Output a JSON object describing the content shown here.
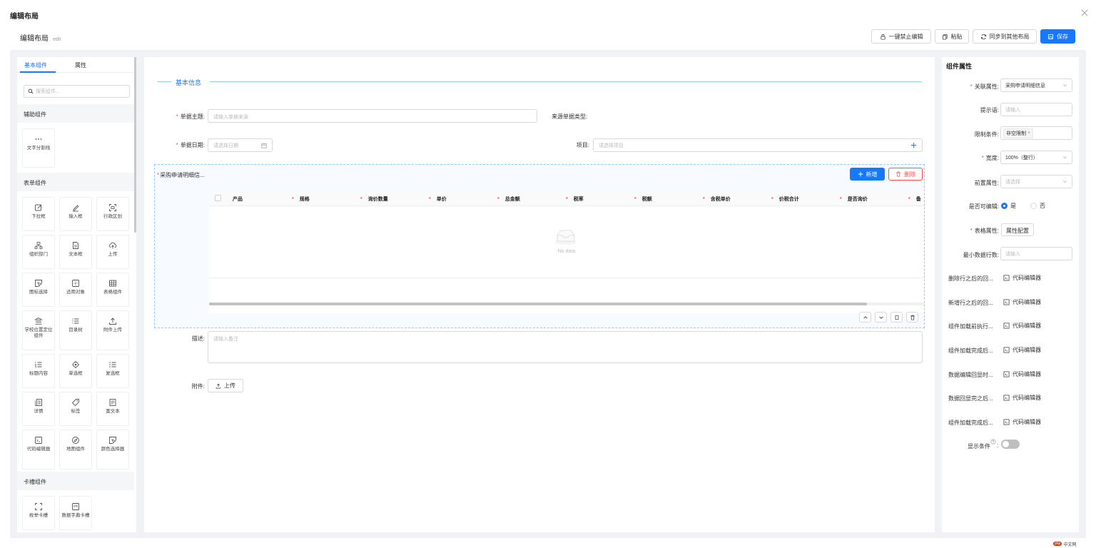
{
  "dialog": {
    "title": "编辑布局"
  },
  "subheader": {
    "title": "编辑布局",
    "tag": "edit"
  },
  "toolbar": {
    "disable_edit": "一键禁止编辑",
    "paste": "粘贴",
    "sync": "同步到其他布局",
    "save": "保存"
  },
  "left": {
    "tabs": [
      "基本组件",
      "属性"
    ],
    "search_placeholder": "搜索组件...",
    "groups": {
      "aux": "辅助组件",
      "form": "表单组件",
      "slot": "卡槽组件"
    },
    "aux_items": [
      {
        "icon": "ellipsis-icon",
        "label": "文字分割线"
      }
    ],
    "form_items": [
      {
        "icon": "edit-icon",
        "label": "下拉框"
      },
      {
        "icon": "pencil-icon",
        "label": "输入框"
      },
      {
        "icon": "region-scan-icon",
        "label": "行政区划"
      },
      {
        "icon": "org-tree-icon",
        "label": "组织部门"
      },
      {
        "icon": "document-icon",
        "label": "文本框"
      },
      {
        "icon": "cloud-upload-icon",
        "label": "上传"
      },
      {
        "icon": "cursor-select-icon",
        "label": "图标选择"
      },
      {
        "icon": "target-box-icon",
        "label": "适用对象"
      },
      {
        "icon": "table-grid-icon",
        "label": "表格组件"
      },
      {
        "icon": "bank-icon",
        "label": "学校位置定位组件"
      },
      {
        "icon": "list-icon",
        "label": "目录树"
      },
      {
        "icon": "upload-icon",
        "label": "附件上传"
      },
      {
        "icon": "ordered-list-icon",
        "label": "标题内容"
      },
      {
        "icon": "aim-icon",
        "label": "单选框"
      },
      {
        "icon": "checklist-icon",
        "label": "复选框"
      },
      {
        "icon": "detail-icon",
        "label": "详情"
      },
      {
        "icon": "tag-icon",
        "label": "标签"
      },
      {
        "icon": "rich-text-icon",
        "label": "富文本"
      },
      {
        "icon": "code-icon",
        "label": "代码编辑器"
      },
      {
        "icon": "compass-icon",
        "label": "地图组件"
      },
      {
        "icon": "color-select-icon",
        "label": "颜色选择器"
      }
    ],
    "slot_items": [
      {
        "icon": "expand-icon",
        "label": "枚举卡槽"
      },
      {
        "icon": "dict-icon",
        "label": "数据字典卡槽"
      }
    ]
  },
  "form": {
    "section_title": "基本信息",
    "subject_label": "单据主题:",
    "subject_placeholder": "请输入单据来源",
    "source_type_label": "来源单据类型:",
    "date_label": "单据日期:",
    "date_placeholder": "请选择日期",
    "project_label": "项目:",
    "project_placeholder": "请选择项目",
    "desc_label": "描述:",
    "desc_placeholder": "请输入备注",
    "attach_label": "附件:",
    "upload_btn": "上传"
  },
  "subtable": {
    "label": "采购申请明细信...",
    "add_btn": "新增",
    "delete_btn": "删除",
    "columns": [
      {
        "name": "产品",
        "required": false
      },
      {
        "name": "规格",
        "required": true
      },
      {
        "name": "询价数量",
        "required": true
      },
      {
        "name": "单价",
        "required": true
      },
      {
        "name": "总金额",
        "required": true
      },
      {
        "name": "税率",
        "required": true
      },
      {
        "name": "税额",
        "required": true
      },
      {
        "name": "含税单价",
        "required": true
      },
      {
        "name": "价税合计",
        "required": true
      },
      {
        "name": "是否询价",
        "required": true
      },
      {
        "name": "备",
        "required": true
      }
    ],
    "empty_text": "No data"
  },
  "props": {
    "title": "组件属性",
    "assoc_label": "关联属性:",
    "assoc_value": "采购申请明细信息",
    "hint_label": "提示语:",
    "hint_placeholder": "请输入",
    "limit_label": "限制条件:",
    "limit_tag": "非空限制",
    "width_label": "宽度:",
    "width_value": "100%（整行）",
    "prefix_label": "前置属性:",
    "prefix_placeholder": "请选择",
    "editable_label": "是否可编辑:",
    "editable_yes": "是",
    "editable_no": "否",
    "table_attr_label": "表格属性:",
    "table_attr_btn": "属性配置",
    "min_rows_label": "最小数据行数:",
    "min_rows_placeholder": "请输入",
    "callbacks": [
      "删除行之后的回...",
      "新增行之后的回...",
      "组件加载前执行...",
      "组件加载完成后...",
      "数据编辑回显时...",
      "数据回显完之后...",
      "组件加载完成后..."
    ],
    "code_editor": "代码编辑器",
    "show_cond_label": "显示条件",
    "show_cond_on": false
  },
  "watermark": {
    "badge": "php",
    "text": "中文网"
  },
  "colors": {
    "primary": "#1677ff",
    "danger": "#ff4d4f",
    "panel_bg": "#f0f2f5"
  }
}
